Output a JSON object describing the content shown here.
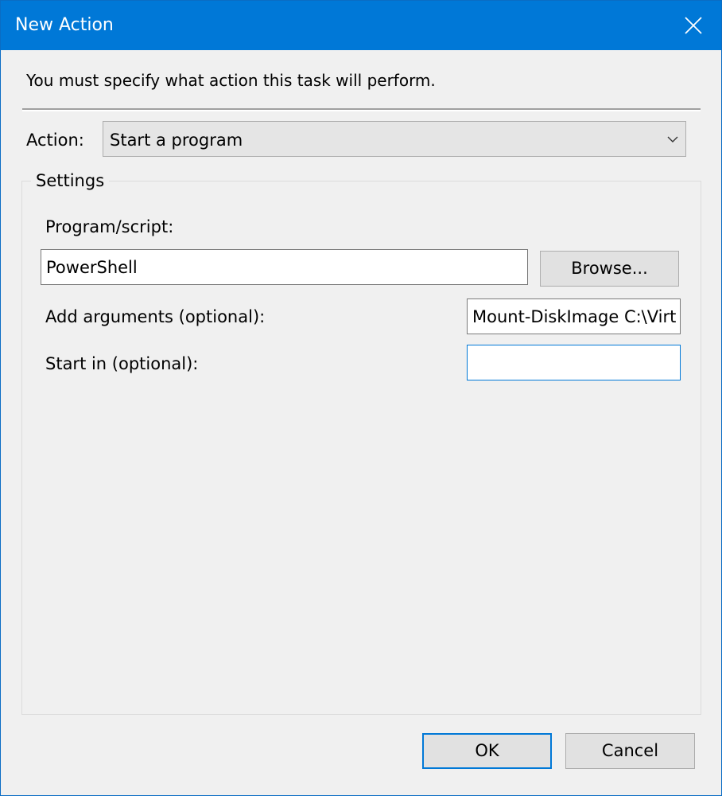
{
  "window": {
    "title": "New Action",
    "close_icon": "close-icon"
  },
  "instruction": "You must specify what action this task will perform.",
  "action": {
    "label": "Action:",
    "selected": "Start a program"
  },
  "settings": {
    "legend": "Settings",
    "program_label": "Program/script:",
    "program_value": "PowerShell",
    "browse_label": "Browse...",
    "arguments_label": "Add arguments (optional):",
    "arguments_value": "Mount-DiskImage C:\\Virt",
    "start_in_label": "Start in (optional):",
    "start_in_value": ""
  },
  "buttons": {
    "ok": "OK",
    "cancel": "Cancel"
  },
  "colors": {
    "titlebar": "#0078d7",
    "background": "#f0f0f0",
    "focus_border": "#0078d7"
  }
}
